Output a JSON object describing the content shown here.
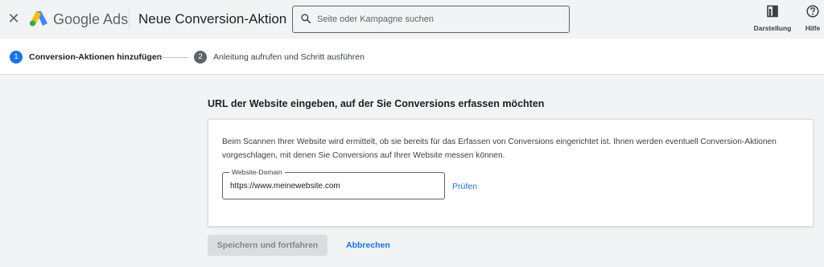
{
  "header": {
    "close_icon": "close-icon",
    "brand": "Google Ads",
    "page_title": "Neue Conversion-Aktion",
    "search_placeholder": "Seite oder Kampagne suchen",
    "tools": [
      {
        "label": "Darstellung",
        "icon": "appearance-icon"
      },
      {
        "label": "Hilfe",
        "icon": "help-icon"
      }
    ]
  },
  "steps": [
    {
      "number": "1",
      "label": "Conversion-Aktionen hinzufügen",
      "active": true
    },
    {
      "number": "2",
      "label": "Anleitung aufrufen und Schritt ausführen",
      "active": false
    }
  ],
  "main": {
    "section_title": "URL der Website eingeben, auf der Sie Conversions erfassen möchten",
    "description": "Beim Scannen Ihrer Website wird ermittelt, ob sie bereits für das Erfassen von Conversions eingerichtet ist. Ihnen werden eventuell Conversion-Aktionen vorgeschlagen, mit denen Sie Conversions auf Ihrer Website messen können.",
    "domain_field": {
      "label": "Website-Domain",
      "value": "https://www.meinewebsite.com"
    },
    "check_label": "Prüfen"
  },
  "footer": {
    "save_label": "Speichern und fortfahren",
    "cancel_label": "Abbrechen"
  },
  "colors": {
    "accent": "#1a73e8",
    "logo_yellow": "#fbbc04",
    "logo_blue": "#4285f4",
    "logo_green": "#34a853",
    "disabled_button": "#dadce0"
  }
}
